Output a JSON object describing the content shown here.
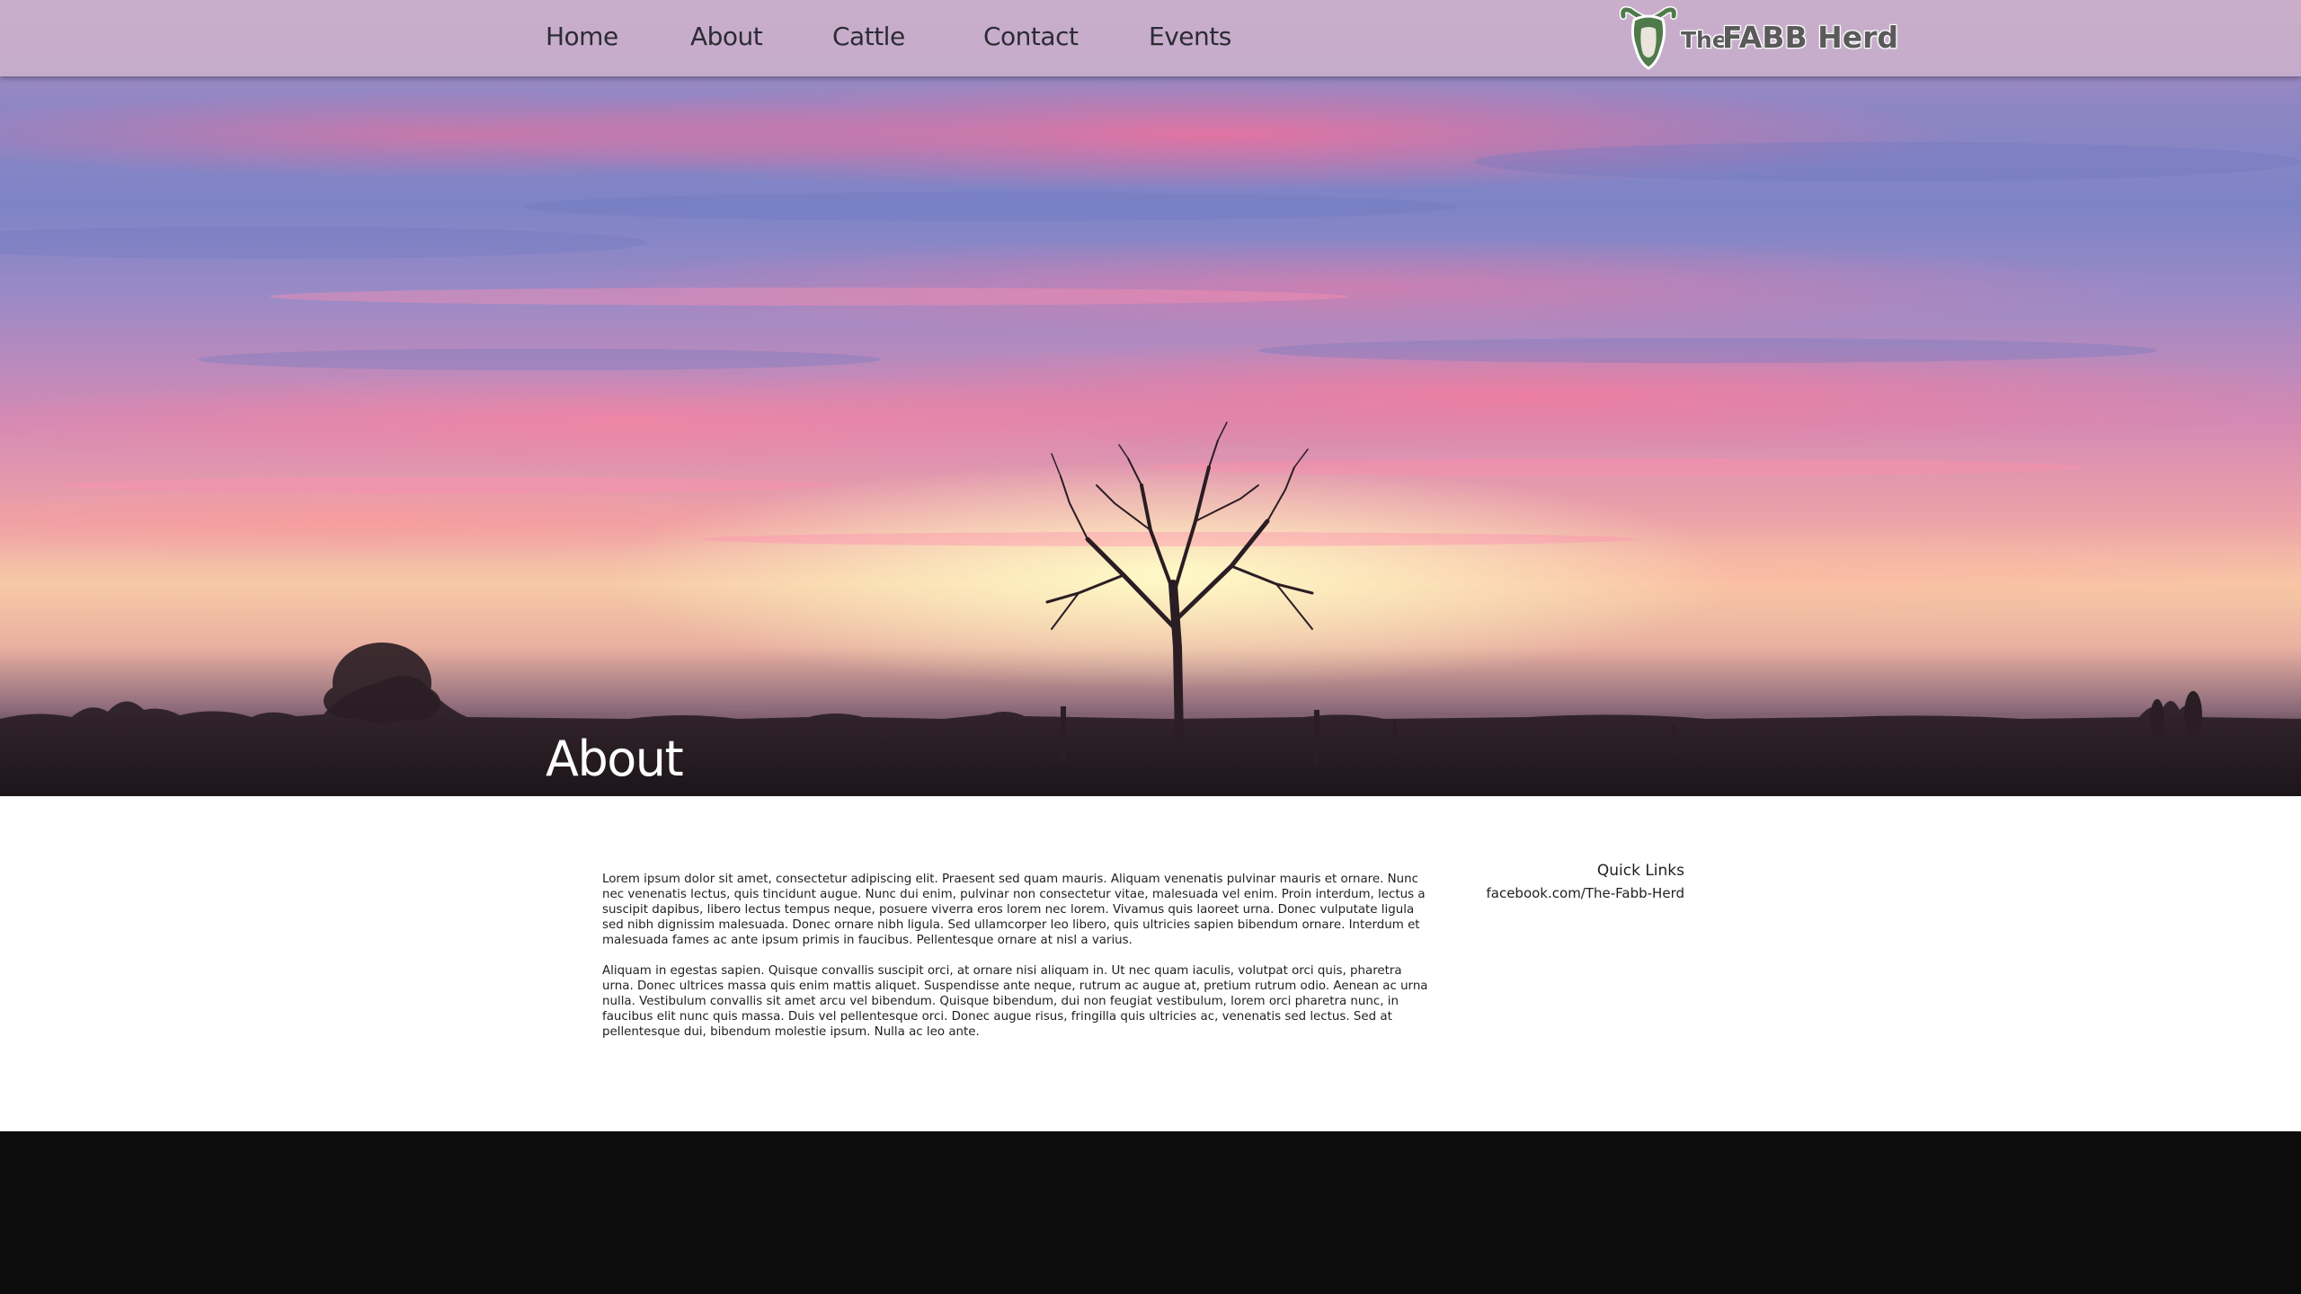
{
  "nav": {
    "items": [
      {
        "label": "Home"
      },
      {
        "label": "About"
      },
      {
        "label": "Cattle"
      },
      {
        "label": "Contact"
      },
      {
        "label": "Events"
      }
    ],
    "logo": {
      "small_text": "The",
      "big_text": "FABB Herd",
      "icon": "cow-head-icon"
    }
  },
  "hero": {
    "title": "About"
  },
  "article": {
    "paragraphs": [
      "Lorem ipsum dolor sit amet, consectetur adipiscing elit. Praesent sed quam mauris. Aliquam venenatis pulvinar mauris et ornare. Nunc nec venenatis lectus, quis tincidunt augue. Nunc dui enim, pulvinar non consectetur vitae, malesuada vel enim. Proin interdum, lectus a suscipit dapibus, libero lectus tempus neque, posuere viverra eros lorem nec lorem. Vivamus quis laoreet urna. Donec vulputate ligula sed nibh dignissim malesuada. Donec ornare nibh ligula. Sed ullamcorper leo libero, quis ultricies sapien bibendum ornare. Interdum et malesuada fames ac ante ipsum primis in faucibus. Pellentesque ornare at nisl a varius.",
      "Aliquam in egestas sapien. Quisque convallis suscipit orci, at ornare nisi aliquam in. Ut nec quam iaculis, volutpat orci quis, pharetra urna. Donec ultrices massa quis enim mattis aliquet. Suspendisse ante neque, rutrum ac augue at, pretium rutrum odio. Aenean ac urna nulla. Vestibulum convallis sit amet arcu vel bibendum. Quisque bibendum, dui non feugiat vestibulum, lorem orci pharetra nunc, in faucibus elit nunc quis massa. Duis vel pellentesque orci. Donec augue risus, fringilla quis ultricies ac, venenatis sed lectus. Sed at pellentesque dui, bibendum molestie ipsum. Nulla ac leo ante."
    ]
  },
  "quick_links": {
    "title": "Quick Links",
    "links": [
      {
        "label": "facebook.com/The-Fabb-Herd"
      }
    ]
  },
  "colors": {
    "nav_bar": "#cdb2cd",
    "nav_text": "#2c2c36",
    "footer": "#0c0c0d",
    "logo_green": "#4f7a4a"
  }
}
